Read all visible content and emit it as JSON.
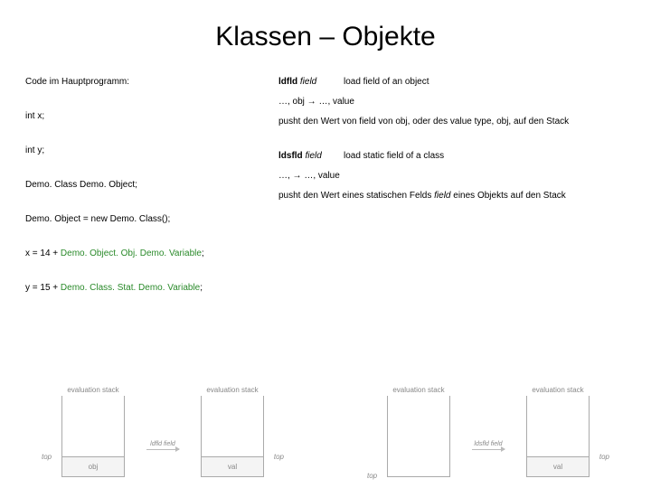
{
  "title": "Klassen – Objekte",
  "left": {
    "header": "Code im Hauptprogramm:",
    "lines": {
      "l1": "int x;",
      "l2": "int y;",
      "l3": "Demo. Class Demo. Object;",
      "l4": "Demo. Object = new Demo. Class();",
      "l5a": "x = 14 + ",
      "l5b": "Demo. Object. Obj. Demo. Variable",
      "l5c": ";",
      "l6a": "y = 15 + ",
      "l6b": "Demo. Class. Stat. Demo. Variable",
      "l6c": ";"
    }
  },
  "right": {
    "r1_name": "ldfld",
    "r1_field": "field",
    "r1_desc": "load field of an object",
    "r2": "…, obj → …, value",
    "r3": "pusht den Wert von field von obj, oder des value type, obj, auf den Stack",
    "r4_name": "ldsfld",
    "r4_field": "field",
    "r4_desc": "load static field of a class",
    "r5": "…, → …, value",
    "r6a": "pusht den Wert eines statischen Felds ",
    "r6b": "field",
    "r6c": " eines Objekts auf den Stack"
  },
  "diag": {
    "caption": "evaluation stack",
    "obj": "obj",
    "val": "val",
    "top": "top",
    "arrow1": "ldfld field",
    "arrow2": "ldsfld field"
  }
}
